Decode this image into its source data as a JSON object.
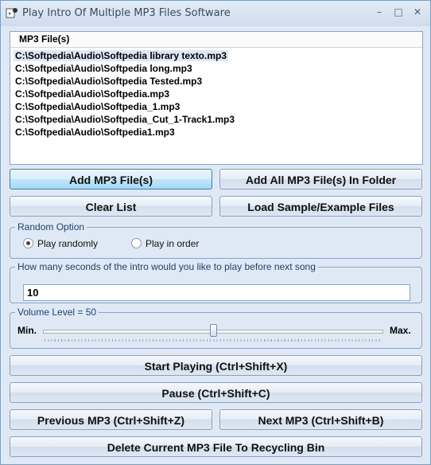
{
  "window": {
    "title": "Play Intro Of Multiple MP3 Files Software",
    "minimize_glyph": "–",
    "maximize_glyph": "□",
    "close_glyph": "✕"
  },
  "file_list": {
    "header": "MP3 File(s)",
    "items": [
      "C:\\Softpedia\\Audio\\Softpedia library texto.mp3",
      "C:\\Softpedia\\Audio\\Softpedia long.mp3",
      "C:\\Softpedia\\Audio\\Softpedia Tested.mp3",
      "C:\\Softpedia\\Audio\\Softpedia.mp3",
      "C:\\Softpedia\\Audio\\Softpedia_1.mp3",
      "C:\\Softpedia\\Audio\\Softpedia_Cut_1-Track1.mp3",
      "C:\\Softpedia\\Audio\\Softpedia1.mp3"
    ],
    "selected_index": 0
  },
  "buttons": {
    "add_files": "Add MP3 File(s)",
    "add_folder": "Add All MP3 File(s) In Folder",
    "clear_list": "Clear List",
    "load_samples": "Load Sample/Example Files",
    "start_playing": "Start Playing (Ctrl+Shift+X)",
    "pause": "Pause (Ctrl+Shift+C)",
    "previous": "Previous MP3 (Ctrl+Shift+Z)",
    "next": "Next MP3 (Ctrl+Shift+B)",
    "delete": "Delete Current MP3 File To Recycling Bin"
  },
  "random_option": {
    "label": "Random Option",
    "play_randomly": "Play randomly",
    "play_in_order": "Play in order",
    "selected": "play_randomly"
  },
  "intro_seconds": {
    "label": "How many seconds of the intro would you like to play before next song",
    "value": "10"
  },
  "volume": {
    "label": "Volume Level = 50",
    "min_label": "Min.",
    "max_label": "Max.",
    "level": 50,
    "max": 100
  },
  "colors": {
    "accent": "#3c7fb1",
    "group_label": "#1f3f6e"
  }
}
